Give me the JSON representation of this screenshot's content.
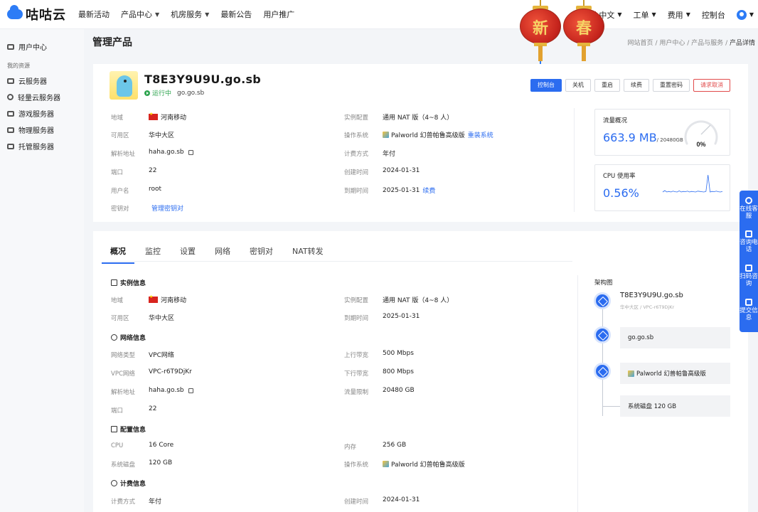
{
  "brand": {
    "name": "咕咕云"
  },
  "nav": {
    "items": [
      {
        "label": "最新活动",
        "dropdown": false
      },
      {
        "label": "产品中心",
        "dropdown": true
      },
      {
        "label": "机房服务",
        "dropdown": true
      },
      {
        "label": "最新公告",
        "dropdown": false
      },
      {
        "label": "用户推广",
        "dropdown": false
      }
    ],
    "right": {
      "language": "中文",
      "ticket": "工单",
      "billing": "费用",
      "console": "控制台"
    }
  },
  "decor": {
    "lantern_left": "新",
    "lantern_right": "春"
  },
  "sidebar": {
    "user_center": "用户中心",
    "section_label": "我的资源",
    "items": [
      {
        "label": "云服务器",
        "icon": "server-icon"
      },
      {
        "label": "轻量云服务器",
        "icon": "lightweight-server-icon"
      },
      {
        "label": "游戏服务器",
        "icon": "game-server-icon"
      },
      {
        "label": "物理服务器",
        "icon": "physical-server-icon"
      },
      {
        "label": "托管服务器",
        "icon": "hosting-server-icon"
      }
    ]
  },
  "header": {
    "title": "管理产品",
    "breadcrumb": [
      "网站首页",
      "用户中心",
      "产品与服务",
      "产品详情"
    ],
    "separator": "/"
  },
  "product": {
    "name": "T8E3Y9U9U.go.sb",
    "status": "运行中",
    "host": "go.go.sb",
    "actions": {
      "console": "控制台",
      "shutdown": "关机",
      "restart": "重启",
      "renew": "续费",
      "reset_password": "重置密码",
      "cancel": "请求取消"
    },
    "fields": {
      "region_label": "地域",
      "region": "河南移动",
      "zone_label": "可用区",
      "zone": "华中大区",
      "dns_label": "解析地址",
      "dns": "haha.go.sb",
      "port_label": "端口",
      "port": "22",
      "username_label": "用户名",
      "username": "root",
      "keypair_label": "密钥对",
      "keypair_link": "管理密钥对",
      "instance_label": "实例配置",
      "instance": "通用 NAT 版（4~8 人）",
      "os_label": "操作系统",
      "os": "Palworld 幻兽帕鲁高级版",
      "reinstall": "重装系统",
      "billing_label": "计费方式",
      "billing": "年付",
      "created_label": "创建时间",
      "created": "2024-01-31",
      "expire_label": "到期时间",
      "expire": "2025-01-31",
      "renew_link": "续费"
    },
    "traffic": {
      "title": "流量概况",
      "used": "663.9 MB",
      "total": "/ 20480GB",
      "percent_label": "0%",
      "percent": 0
    },
    "cpu": {
      "title": "CPU 使用率",
      "value": "0.56%",
      "sparkline": [
        0.3,
        0.35,
        0.3,
        0.32,
        0.3,
        0.33,
        0.31,
        0.3,
        0.34,
        0.3,
        0.32,
        0.31,
        0.33,
        0.3,
        0.32,
        0.31,
        0.3,
        0.33,
        0.32,
        0.31,
        0.3,
        0.32,
        0.9,
        0.3,
        0.32,
        0.31,
        0.33,
        0.31,
        0.3,
        0.32
      ]
    }
  },
  "tabs": [
    "概况",
    "监控",
    "设置",
    "网络",
    "密钥对",
    "NAT转发"
  ],
  "overview": {
    "instance_section": "实例信息",
    "network_section": "网络信息",
    "config_section": "配置信息",
    "billing_section": "计费信息",
    "region_label": "地域",
    "region": "河南移动",
    "instance_label": "实例配置",
    "instance": "通用 NAT 版（4~8 人）",
    "zone_label": "可用区",
    "zone": "华中大区",
    "expire_label": "到期时间",
    "expire": "2025-01-31",
    "net_type_label": "网络类型",
    "net_type": "VPC网络",
    "up_label": "上行带宽",
    "up": "500 Mbps",
    "vpc_label": "VPC网络",
    "vpc": "VPC-r6T9DjKr",
    "down_label": "下行带宽",
    "down": "800 Mbps",
    "dns_label": "解析地址",
    "dns": "haha.go.sb",
    "traffic_limit_label": "流量限制",
    "traffic_limit": "20480 GB",
    "port_label": "端口",
    "port": "22",
    "cpu_label": "CPU",
    "cpu": "16 Core",
    "mem_label": "内存",
    "mem": "256 GB",
    "disk_label": "系统磁盘",
    "disk": "120 GB",
    "os_label": "操作系统",
    "os": "Palworld 幻兽帕鲁高级版",
    "bill_label": "计费方式",
    "bill": "年付",
    "created_label": "创建时间",
    "created": "2024-01-31"
  },
  "architecture": {
    "title": "架构图",
    "instance": "T8E3Y9U9U.go.sb",
    "instance_sub": "华中大区 / VPC-r6T9DjKr",
    "network": "go.go.sb",
    "image": "Palworld 幻兽帕鲁高级版",
    "disk": "系统磁盘 120 GB"
  },
  "float": [
    {
      "label": "在线客服",
      "icon": "headset-icon"
    },
    {
      "label": "咨询电话",
      "icon": "phone-icon"
    },
    {
      "label": "扫码咨询",
      "icon": "qr-scan-icon"
    },
    {
      "label": "提交信息",
      "icon": "form-icon"
    }
  ]
}
